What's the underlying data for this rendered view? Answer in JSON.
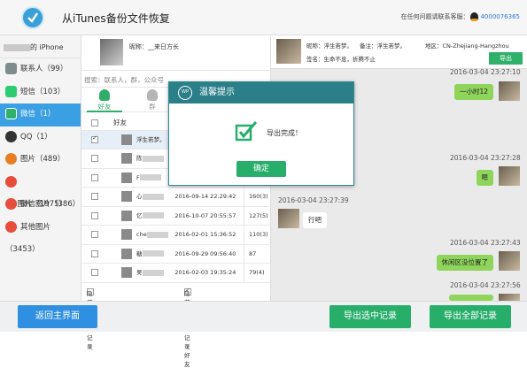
{
  "title": "从iTunes备份文件恢复",
  "support": {
    "text": "在任何问题请联系客服：",
    "phone": "4000076365"
  },
  "sidebar": {
    "device": "的 iPhone",
    "items": [
      {
        "label": "联系人（99）",
        "color": "#7f8c8d"
      },
      {
        "label": "短信（103）",
        "color": "#2ecc71"
      },
      {
        "label": "微信（1）",
        "color": "#2fb06b"
      },
      {
        "label": "QQ（1）",
        "color": "#333333"
      },
      {
        "label": "图片（489）",
        "color": "#e67e22"
      },
      {
        "label": "QQ图片（1975）",
        "color": "#e74c3c"
      },
      {
        "label": "微信图片（386）",
        "color": "#e74c3c"
      },
      {
        "label": "其他图片（3453）",
        "color": "#e74c3c"
      }
    ]
  },
  "me": {
    "nickname": "昵称：__来日方长"
  },
  "search": {
    "placeholder": "搜索：联系人，群，公众号"
  },
  "tabs": {
    "friends": "好友",
    "groups": "群"
  },
  "contacts": {
    "header": "好友",
    "rows": [
      {
        "name": "浮生若梦。",
        "date": "",
        "count": ""
      },
      {
        "name": "陈",
        "date": "",
        "count": ""
      },
      {
        "name": "F",
        "date": "",
        "count": ""
      },
      {
        "name": "心",
        "date": "2016-09-14 22:29:42",
        "count": "160(3)"
      },
      {
        "name": "忆",
        "date": "2016-10-07 20:55:57",
        "count": "127(5)"
      },
      {
        "name": "che",
        "date": "2016-02-01 15:36:52",
        "count": "110(3)"
      },
      {
        "name": "糖",
        "date": "2016-09-29 09:56:40",
        "count": "87"
      },
      {
        "name": "吴",
        "date": "2016-02-03 19:35:24",
        "count": "79(4)"
      }
    ],
    "hide_deleted": "隐藏未删除记录",
    "hide_no_chat": "隐藏无聊天记录好友"
  },
  "chat_head": {
    "nickname": "昵称：浮生若梦。",
    "remark": "备注：浮生若梦。",
    "region": "地区：CN-Zhejiang-Hangzhou",
    "signature": "签名：生命不息，折腾不止",
    "export": "导出"
  },
  "messages": [
    {
      "time": "2016-03-04 23:27:10",
      "text": "一小时12",
      "side": "right"
    },
    {
      "time": "2016-03-04 23:27:28",
      "text": "嗯",
      "side": "right"
    },
    {
      "time": "2016-03-04 23:27:39",
      "text": "行吧",
      "side": "left"
    },
    {
      "time": "2016-03-04 23:27:43",
      "text": "休闲区没位置了",
      "side": "right"
    },
    {
      "time": "2016-03-04 23:27:56",
      "text": "",
      "side": "right"
    }
  ],
  "modal": {
    "title": "温馨提示",
    "logo": "WP",
    "message": "导出完成！",
    "ok": "确定"
  },
  "footer": {
    "back": "返回主界面",
    "export_selected": "导出选中记录",
    "export_all": "导出全部记录"
  }
}
